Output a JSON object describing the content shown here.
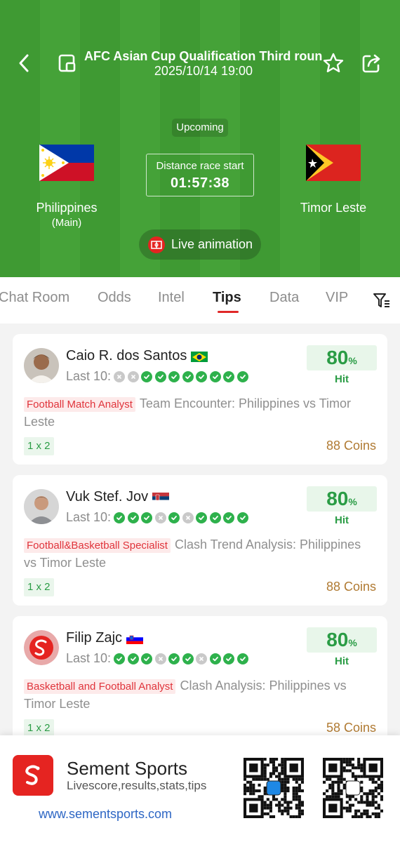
{
  "match": {
    "title": "AFC Asian Cup Qualification Third roun...",
    "datetime": "2025/10/14 19:00",
    "status": "Upcoming",
    "countdown_label": "Distance race start",
    "countdown_time": "01:57:38",
    "live_label": "Live animation",
    "home": {
      "name": "Philippines",
      "tag": "(Main)"
    },
    "away": {
      "name": "Timor Leste"
    }
  },
  "tabs": [
    "Chat Room",
    "Odds",
    "Intel",
    "Tips",
    "Data",
    "VIP"
  ],
  "active_tab": "Tips",
  "tips": [
    {
      "name": "Caio R. dos Santos",
      "country_flag": "brazil",
      "last10_label": "Last 10:",
      "results": [
        "L",
        "L",
        "W",
        "W",
        "W",
        "W",
        "W",
        "W",
        "W",
        "W"
      ],
      "hit_pct": "80",
      "hit_unit": "%",
      "hit_label": "Hit",
      "role": "Football Match Analyst",
      "title": "Team Encounter: Philippines vs Timor Leste",
      "odds": "1 x 2",
      "coins": "88 Coins"
    },
    {
      "name": "Vuk Stef. Jov",
      "country_flag": "serbia",
      "last10_label": "Last 10:",
      "results": [
        "W",
        "W",
        "W",
        "L",
        "W",
        "L",
        "W",
        "W",
        "W",
        "W"
      ],
      "hit_pct": "80",
      "hit_unit": "%",
      "hit_label": "Hit",
      "role": "Football&Basketball Specialist",
      "title": "Clash Trend Analysis: Philippines vs Timor Leste",
      "odds": "1 x 2",
      "coins": "88 Coins"
    },
    {
      "name": "Filip Zajc",
      "country_flag": "slovenia",
      "last10_label": "Last 10:",
      "results": [
        "W",
        "W",
        "W",
        "L",
        "W",
        "W",
        "L",
        "W",
        "W",
        "W"
      ],
      "hit_pct": "80",
      "hit_unit": "%",
      "hit_label": "Hit",
      "role": "Basketball and Football Analyst",
      "title": "Clash Analysis: Philippines vs Timor Leste",
      "odds": "1 x 2",
      "coins": "58 Coins"
    }
  ],
  "banner": {
    "title": "Sement Sports",
    "subtitle": "Livescore,results,stats,tips",
    "url": "www.sementsports.com"
  },
  "colors": {
    "pitch": "#3f9a33",
    "accent": "#e02828",
    "hit_green": "#2a9c45",
    "coins": "#b07a32",
    "link": "#2d66c4"
  }
}
